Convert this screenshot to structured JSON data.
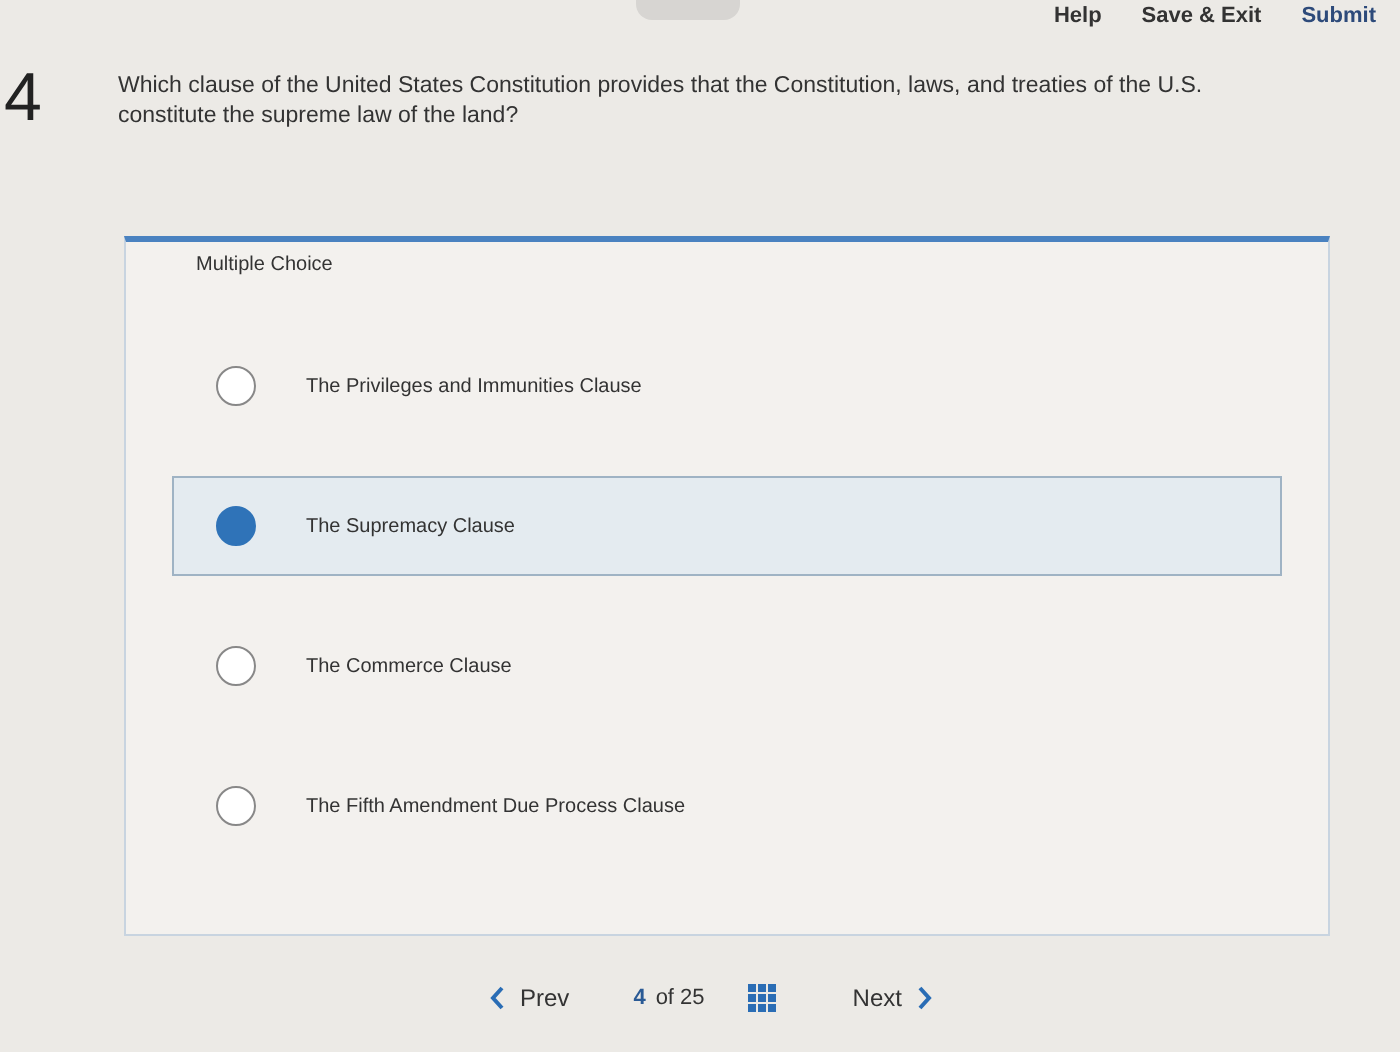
{
  "header_links": [
    "Help",
    "Save & Exit",
    "Submit"
  ],
  "question": {
    "number": "4",
    "text": "Which clause of the United States Constitution provides that the Constitution, laws, and treaties of the U.S. constitute the supreme law of the land?",
    "type_label": "Multiple Choice",
    "options": [
      {
        "label": "The Privileges and Immunities Clause",
        "selected": false
      },
      {
        "label": "The Supremacy Clause",
        "selected": true
      },
      {
        "label": "The Commerce Clause",
        "selected": false
      },
      {
        "label": "The Fifth Amendment Due Process Clause",
        "selected": false
      }
    ]
  },
  "nav": {
    "prev": "Prev",
    "current": "4",
    "total": "of 25",
    "next": "Next"
  }
}
